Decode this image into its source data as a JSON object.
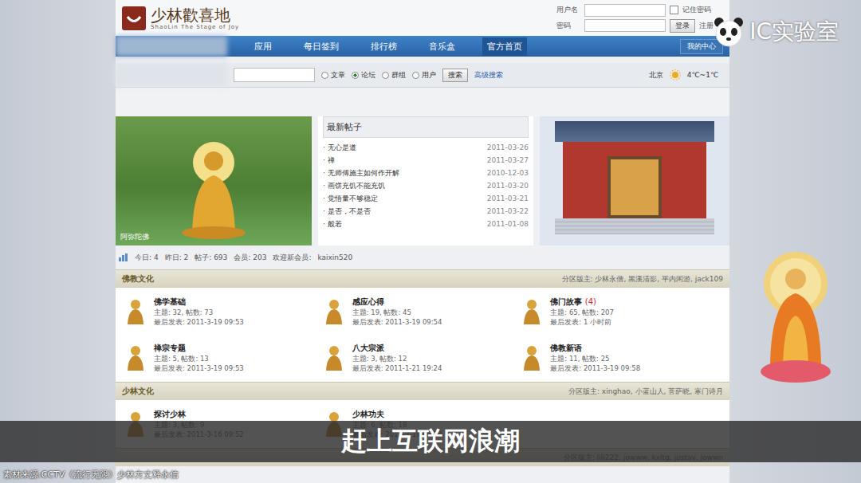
{
  "logo": {
    "title": "少林歡喜地",
    "subtitle": "ShaoLin The Stage of Joy"
  },
  "login": {
    "username_label": "用户名",
    "password_label": "密码",
    "remember": "记住密码",
    "remember_checked": false,
    "login_button": "登录",
    "register": "注册"
  },
  "nav": {
    "items": [
      {
        "label": "应用",
        "selected": false
      },
      {
        "label": "每日签到",
        "selected": false
      },
      {
        "label": "排行榜",
        "selected": false
      },
      {
        "label": "音乐盒",
        "selected": false
      },
      {
        "label": "官方首页",
        "selected": true
      }
    ],
    "right": "我的中心"
  },
  "search": {
    "options": [
      {
        "label": "文章",
        "selected": false
      },
      {
        "label": "论坛",
        "selected": true
      },
      {
        "label": "群组",
        "selected": false
      },
      {
        "label": "用户",
        "selected": false
      }
    ],
    "button": "搜索",
    "advanced": "高级搜索",
    "city": "北京",
    "temperature": "4℃~1℃"
  },
  "hero": {
    "left_caption": "阿弥陀佛",
    "latest_title": "最新帖子",
    "latest": [
      {
        "title": "无心是道",
        "date": "2011-03-26"
      },
      {
        "title": "禅",
        "date": "2011-03-27"
      },
      {
        "title": "无师傅施主如何作开解",
        "date": "2010-12-03"
      },
      {
        "title": "画饼充饥不能充饥",
        "date": "2011-03-20"
      },
      {
        "title": "觉悟量不够稳定",
        "date": "2011-03-21"
      },
      {
        "title": "是否，不是否",
        "date": "2011-03-22"
      },
      {
        "title": "般若",
        "date": "2011-01-08"
      }
    ]
  },
  "stats": {
    "items": [
      "今日: 4",
      "昨日: 2",
      "帖子: 693",
      "会员: 203"
    ],
    "new_member_label": "欢迎新会员:",
    "new_member": "kaixin520"
  },
  "sections": [
    {
      "title": "佛教文化",
      "moderators": "分区版主: 少林永僧, 黑溪清影, 平内闲游, jack109",
      "forums": [
        {
          "name": "佛学基础",
          "badge": "",
          "counts": "主题: 32, 帖数: 73",
          "last": "最后发表: 2011-3-19 09:53"
        },
        {
          "name": "感应心得",
          "badge": "",
          "counts": "主题: 19, 帖数: 45",
          "last": "最后发表: 2011-3-19 09:54"
        },
        {
          "name": "佛门故事",
          "badge": "(4)",
          "counts": "主题: 65, 帖数: 207",
          "last": "最后发表: 1 小时前"
        },
        {
          "name": "禅宗专题",
          "badge": "",
          "counts": "主题: 5, 帖数: 13",
          "last": "最后发表: 2011-3-19 09:53"
        },
        {
          "name": "八大宗派",
          "badge": "",
          "counts": "主题: 3, 帖数: 12",
          "last": "最后发表: 2011-1-21 19:24"
        },
        {
          "name": "佛教新语",
          "badge": "",
          "counts": "主题: 11, 帖数: 25",
          "last": "最后发表: 2011-3-19 09:58"
        }
      ]
    },
    {
      "title": "少林文化",
      "moderators": "分区版主: xinghao, 小蓝山人, 菩萨晓, 寒门诗月",
      "forums": [
        {
          "name": "探讨少林",
          "badge": "",
          "counts": "主题: 3, 帖数: 9",
          "last": "最后发表: 2011-3-16 09:52"
        },
        {
          "name": "少林功夫",
          "badge": "",
          "counts": "主题: 6, 帖数: 18",
          "last": "最后发表: 2011-3-19 09:50"
        }
      ]
    },
    {
      "title": "",
      "moderators": "分区版主: lili222, jowww, kxltg, justav, jowwn",
      "forums": []
    }
  ],
  "video": {
    "watermark": "IC实验室",
    "subtitle": "赶上互联网浪潮",
    "source": "素材来源:CCTV《流行无限》少林方丈释永信"
  }
}
